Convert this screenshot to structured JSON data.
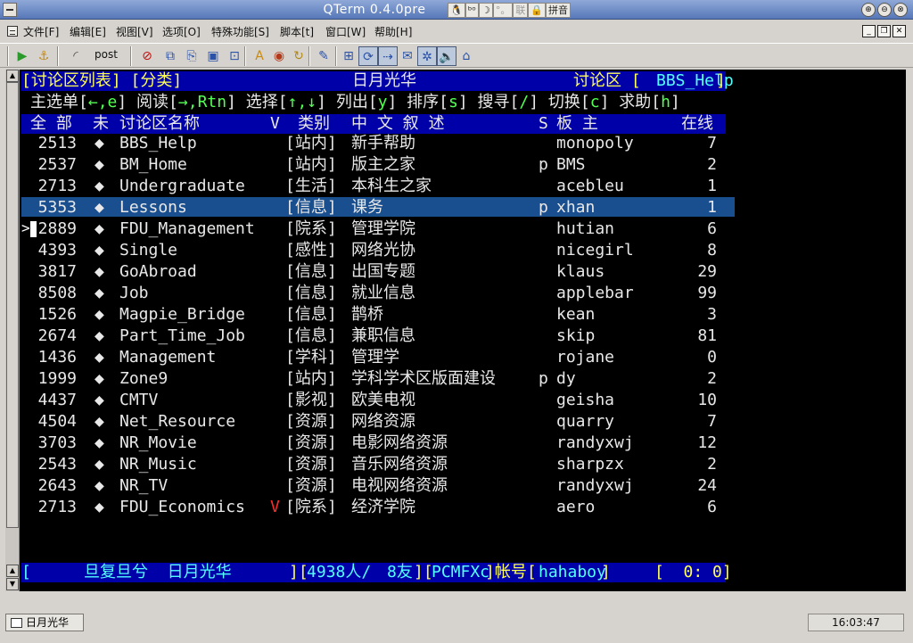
{
  "window": {
    "title": "QTerm 0.4.0pre",
    "tray": [
      "拼音"
    ],
    "controls": [
      "⊕",
      "⊖",
      "⊗"
    ]
  },
  "menu": [
    "文件[F]",
    "编辑[E]",
    "视图[V]",
    "选项[O]",
    "特殊功能[S]",
    "脚本[t]",
    "窗口[W]",
    "帮助[H]"
  ],
  "toolbar": {
    "post_label": "post"
  },
  "screen": {
    "header": {
      "left": "[讨论区列表] [分类]",
      "center": "日月光华",
      "right_label": "讨论区 [",
      "right_board": "BBS_Help",
      "right_close": "]"
    },
    "help_line": [
      {
        "t": "主选单[",
        "c": "w"
      },
      {
        "t": "←",
        "c": "g"
      },
      {
        "t": ",e",
        "c": "g"
      },
      {
        "t": "] 阅读[",
        "c": "w"
      },
      {
        "t": "→",
        "c": "g"
      },
      {
        "t": ",Rtn",
        "c": "g"
      },
      {
        "t": "] 选择[",
        "c": "w"
      },
      {
        "t": "↑",
        "c": "g"
      },
      {
        "t": ",",
        "c": "g"
      },
      {
        "t": "↓",
        "c": "g"
      },
      {
        "t": "] 列出[",
        "c": "w"
      },
      {
        "t": "y",
        "c": "g"
      },
      {
        "t": "] 排序[",
        "c": "w"
      },
      {
        "t": "s",
        "c": "g"
      },
      {
        "t": "] 搜寻[",
        "c": "w"
      },
      {
        "t": "/",
        "c": "g"
      },
      {
        "t": "] 切换[",
        "c": "w"
      },
      {
        "t": "c",
        "c": "g"
      },
      {
        "t": "] 求助[",
        "c": "w"
      },
      {
        "t": "h",
        "c": "g"
      },
      {
        "t": "]",
        "c": "w"
      }
    ],
    "columns": {
      "all": "全 部",
      "unread": "未",
      "name": "讨论区名称",
      "v": "V",
      "category": "类别",
      "desc": "中 文 叙 述",
      "s": "S",
      "bm": "板 主",
      "online": "在线"
    },
    "rows": [
      {
        "num": "2513",
        "name": "BBS_Help",
        "v": "",
        "cat": "[站内]",
        "desc": "新手帮助",
        "s": "",
        "bm": "monopoly",
        "online": "7"
      },
      {
        "num": "2537",
        "name": "BM_Home",
        "v": "",
        "cat": "[站内]",
        "desc": "版主之家",
        "s": "p",
        "bm": "BMS",
        "online": "2"
      },
      {
        "num": "2713",
        "name": "Undergraduate",
        "v": "",
        "cat": "[生活]",
        "desc": "本科生之家",
        "s": "",
        "bm": "acebleu",
        "online": "1"
      },
      {
        "num": "5353",
        "name": "Lessons",
        "v": "",
        "cat": "[信息]",
        "desc": "课务",
        "s": "p",
        "bm": "xhan",
        "online": "1"
      },
      {
        "num": "2889",
        "name": "FDU_Management",
        "v": "",
        "cat": "[院系]",
        "desc": "管理学院",
        "s": "",
        "bm": "hutian",
        "online": "6"
      },
      {
        "num": "4393",
        "name": "Single",
        "v": "",
        "cat": "[感性]",
        "desc": "网络光协",
        "s": "",
        "bm": "nicegirl",
        "online": "8"
      },
      {
        "num": "3817",
        "name": "GoAbroad",
        "v": "",
        "cat": "[信息]",
        "desc": "出国专题",
        "s": "",
        "bm": "klaus",
        "online": "29"
      },
      {
        "num": "8508",
        "name": "Job",
        "v": "",
        "cat": "[信息]",
        "desc": "就业信息",
        "s": "",
        "bm": "applebar",
        "online": "99"
      },
      {
        "num": "1526",
        "name": "Magpie_Bridge",
        "v": "",
        "cat": "[信息]",
        "desc": "鹊桥",
        "s": "",
        "bm": "kean",
        "online": "3"
      },
      {
        "num": "2674",
        "name": "Part_Time_Job",
        "v": "",
        "cat": "[信息]",
        "desc": "兼职信息",
        "s": "",
        "bm": "skip",
        "online": "81"
      },
      {
        "num": "1436",
        "name": "Management",
        "v": "",
        "cat": "[学科]",
        "desc": "管理学",
        "s": "",
        "bm": "rojane",
        "online": "0"
      },
      {
        "num": "1999",
        "name": "Zone9",
        "v": "",
        "cat": "[站内]",
        "desc": "学科学术区版面建设",
        "s": "p",
        "bm": "dy",
        "online": "2"
      },
      {
        "num": "4437",
        "name": "CMTV",
        "v": "",
        "cat": "[影视]",
        "desc": "欧美电视",
        "s": "",
        "bm": "geisha",
        "online": "10"
      },
      {
        "num": "4504",
        "name": "Net_Resource",
        "v": "",
        "cat": "[资源]",
        "desc": "网络资源",
        "s": "",
        "bm": "quarry",
        "online": "7"
      },
      {
        "num": "3703",
        "name": "NR_Movie",
        "v": "",
        "cat": "[资源]",
        "desc": "电影网络资源",
        "s": "",
        "bm": "randyxwj",
        "online": "12"
      },
      {
        "num": "2543",
        "name": "NR_Music",
        "v": "",
        "cat": "[资源]",
        "desc": "音乐网络资源",
        "s": "",
        "bm": "sharpzx",
        "online": "2"
      },
      {
        "num": "2643",
        "name": "NR_TV",
        "v": "",
        "cat": "[资源]",
        "desc": "电视网络资源",
        "s": "",
        "bm": "randyxwj",
        "online": "24"
      },
      {
        "num": "2713",
        "name": "FDU_Economics",
        "v": "V",
        "cat": "[院系]",
        "desc": "经济学院",
        "s": "",
        "bm": "aero",
        "online": "6"
      }
    ],
    "selected_index": 3,
    "cursor_index": 4,
    "status": {
      "open": "[",
      "site": "旦复旦兮  日月光华",
      "sep": "][",
      "users": "4938人/",
      "friends": "8友",
      "mid": "][",
      "term": "PCMFXc",
      "acct_label": "]帐号[",
      "acct": "hahaboy",
      "close": "]",
      "time": "[  0: 0]"
    }
  },
  "taskbar": {
    "active_tab": "日月光华",
    "clock": "16:03:47"
  }
}
